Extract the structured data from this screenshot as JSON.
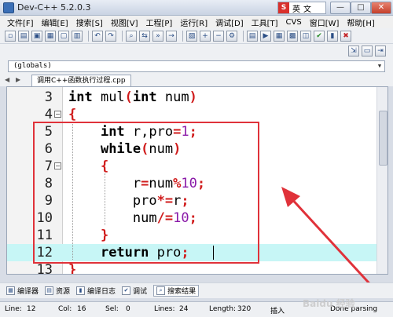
{
  "window": {
    "title": "Dev-C++ 5.2.0.3"
  },
  "ime": {
    "badge": "S",
    "text1": "英",
    "text2": "文"
  },
  "window_controls": {
    "minimize": "—",
    "maximize": "□",
    "close": "✕"
  },
  "menu": [
    "文件[F]",
    "编辑[E]",
    "搜索[S]",
    "视图[V]",
    "工程[P]",
    "运行[R]",
    "调试[D]",
    "工具[T]",
    "CVS",
    "窗口[W]",
    "帮助[H]"
  ],
  "class_browser": {
    "value": "(globals)"
  },
  "tab": {
    "label": "调用C++函数执行过程.cpp"
  },
  "editor": {
    "lines": [
      {
        "num": "3",
        "fold": ""
      },
      {
        "num": "4",
        "fold": "⊟"
      },
      {
        "num": "5",
        "fold": ""
      },
      {
        "num": "6",
        "fold": ""
      },
      {
        "num": "7",
        "fold": "⊟"
      },
      {
        "num": "8",
        "fold": ""
      },
      {
        "num": "9",
        "fold": ""
      },
      {
        "num": "10",
        "fold": ""
      },
      {
        "num": "11",
        "fold": ""
      },
      {
        "num": "12",
        "fold": ""
      },
      {
        "num": "13",
        "fold": ""
      }
    ],
    "tokens": {
      "l3_kw1": "int",
      "l3_id": " mul",
      "l3_p1": "(",
      "l3_kw2": "int",
      "l3_id2": " num",
      "l3_p2": ")",
      "l4_brace": "{",
      "l5_kw": "int",
      "l5_id": " r,pro",
      "l5_eq": "=",
      "l5_num": "1",
      "l5_semi": ";",
      "l6_kw": "while",
      "l6_p1": "(",
      "l6_id": "num",
      "l6_p2": ")",
      "l7_brace": "{",
      "l8_id": "r",
      "l8_eq": "=",
      "l8_id2": "num",
      "l8_mod": "%",
      "l8_num": "10",
      "l8_semi": ";",
      "l9_id": "pro",
      "l9_op": "*=",
      "l9_id2": "r",
      "l9_semi": ";",
      "l10_id": "num",
      "l10_op": "/=",
      "l10_num": "10",
      "l10_semi": ";",
      "l11_brace": "}",
      "l12_kw": "return",
      "l12_id": " pro",
      "l12_semi": ";",
      "l13_brace": "}"
    }
  },
  "bottom_tabs": [
    "编译器",
    "资源",
    "编译日志",
    "调试",
    "搜索结果"
  ],
  "status": {
    "line_label": "Line:",
    "line_value": "12",
    "col_label": "Col:",
    "col_value": "16",
    "sel_label": "Sel:",
    "sel_value": "0",
    "lines_label": "Lines:",
    "lines_value": "24",
    "length_label": "Length:",
    "length_value": "320",
    "mode": "插入",
    "message": "Done parsing"
  },
  "watermark": "Baidu 经验",
  "colors": {
    "highlight_box": "#e0323a",
    "active_line": "#c7f6f6",
    "operator": "#d01c1c",
    "number": "#8a1aa8"
  }
}
